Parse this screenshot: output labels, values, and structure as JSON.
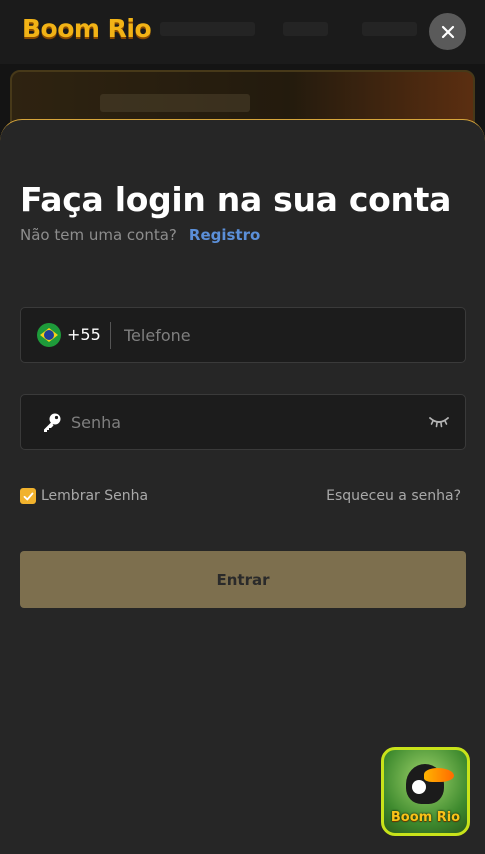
{
  "header": {
    "logo_text": "Boom Rio"
  },
  "login": {
    "title": "Faça login na sua conta",
    "no_account_text": "Não tem uma conta?",
    "register_link": "Registro",
    "phone": {
      "country_flag": "brazil-flag-icon",
      "dial_code": "+55",
      "placeholder": "Telefone",
      "value": ""
    },
    "password": {
      "placeholder": "Senha",
      "value": "",
      "leading_icon": "key-icon",
      "toggle_icon": "eye-closed-icon"
    },
    "remember_label": "Lembrar Senha",
    "remember_checked": true,
    "forgot_link": "Esqueceu a senha?",
    "submit_label": "Entrar"
  },
  "floating_app": {
    "label": "Boom Rio"
  },
  "colors": {
    "accent": "#f1b22d",
    "submit_bg": "#7d6f4e",
    "link": "#5b8fd8",
    "sheet_bg": "#262626",
    "sheet_border": "#d6a53b"
  }
}
